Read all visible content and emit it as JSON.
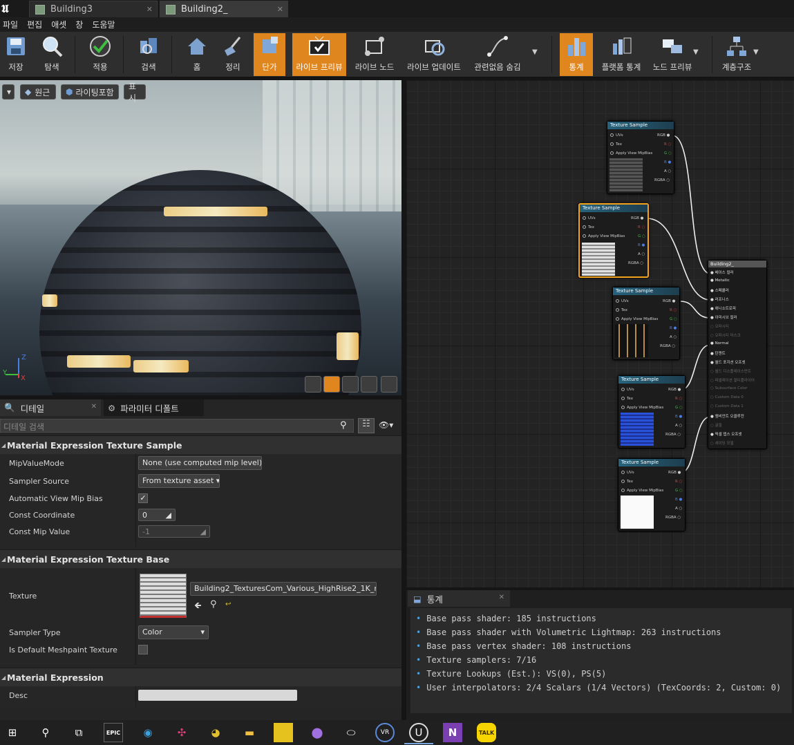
{
  "tabs": [
    {
      "label": "Building3",
      "active": false
    },
    {
      "label": "Building2_",
      "active": true
    }
  ],
  "menu": [
    "파일",
    "편집",
    "애셋",
    "창",
    "도움말"
  ],
  "toolbar": {
    "save": "저장",
    "browse": "탐색",
    "apply": "적용",
    "search": "검색",
    "home": "홈",
    "clean_up": "정리",
    "hlsl": "단가",
    "live_preview": "라이브 프리뷰",
    "live_nodes": "라이브 노드",
    "live_update": "라이브 업데이트",
    "hide_unrelated": "관련없음 숨김",
    "stats": "통계",
    "platform_stats": "플랫폼 통계",
    "node_preview": "노드 프리뷰",
    "hierarchy": "계층구조"
  },
  "viewport": {
    "perspective": "원근",
    "lit": "라이팅포함",
    "show": "표시",
    "axis_z": "Z",
    "axis_y": "Y",
    "axis_x": "X"
  },
  "details": {
    "tab_details": "디테일",
    "tab_params": "파라미터 디폴트",
    "search_placeholder": "디테일 검색",
    "section1": "Material Expression Texture Sample",
    "mip_value_mode_label": "MipValueMode",
    "mip_value_mode": "None (use computed mip level)",
    "sampler_source_label": "Sampler Source",
    "sampler_source": "From texture asset",
    "auto_mip_bias_label": "Automatic View Mip Bias",
    "auto_mip_bias_checked": "✓",
    "const_coord_label": "Const Coordinate",
    "const_coord": "0",
    "const_mip_label": "Const Mip Value",
    "const_mip": "-1",
    "section2": "Material Expression Texture Base",
    "texture_label": "Texture",
    "texture_asset": "Building2_TexturesCom_Various_HighRise2_1K_rou",
    "texture_nav_icon": "↩",
    "sampler_type_label": "Sampler Type",
    "sampler_type": "Color",
    "default_meshpaint_label": "Is Default Meshpaint Texture",
    "section3": "Material Expression",
    "desc_label": "Desc",
    "desc": ""
  },
  "graph": {
    "node_title": "Texture Sample",
    "pins_in": [
      "UVs",
      "Tex",
      "Apply View MipBias"
    ],
    "pins_out": [
      "RGB",
      "R",
      "G",
      "B",
      "A",
      "RGBA"
    ],
    "result_title": "Building2_",
    "result_pins": [
      {
        "label": "베이스 컬러",
        "active": true
      },
      {
        "label": "Metallic",
        "active": true
      },
      {
        "label": "스페큘러",
        "active": true
      },
      {
        "label": "러프니스",
        "active": true
      },
      {
        "label": "애니소트로피",
        "active": true
      },
      {
        "label": "이미시브 컬러",
        "active": true
      },
      {
        "label": "오파시티",
        "active": false
      },
      {
        "label": "오파시티 마스크",
        "active": false
      },
      {
        "label": "Normal",
        "active": true
      },
      {
        "label": "탄젠트",
        "active": true
      },
      {
        "label": "월드 포지션 오프셋",
        "active": true
      },
      {
        "label": "월드 디스플레이스먼트",
        "active": false
      },
      {
        "label": "테셀레이션 멀티플라이어",
        "active": false
      },
      {
        "label": "Subsurface Color",
        "active": false
      },
      {
        "label": "Custom Data 0",
        "active": false
      },
      {
        "label": "Custom Data 1",
        "active": false
      },
      {
        "label": "앰비언트 오클루전",
        "active": true
      },
      {
        "label": "굴절",
        "active": false
      },
      {
        "label": "픽셀 뎁스 오프셋",
        "active": true
      },
      {
        "label": "셰이딩 모델",
        "active": false
      }
    ]
  },
  "stats": {
    "tab": "통계",
    "lines": [
      "Base pass shader: 185 instructions",
      "Base pass shader with Volumetric Lightmap: 263 instructions",
      "Base pass vertex shader: 108 instructions",
      "Texture samplers: 7/16",
      "Texture Lookups (Est.): VS(0), PS(5)",
      "User interpolators: 2/4 Scalars (1/4 Vectors) (TexCoords: 2, Custom: 0)"
    ]
  },
  "taskbar": {
    "epic": "EPIC",
    "vr": "VR",
    "onenote": "N",
    "kakao": "TALK"
  },
  "colors": {
    "accent": "#e0861f",
    "node_header": "#27637d",
    "selected_node": "#f3a21d"
  }
}
